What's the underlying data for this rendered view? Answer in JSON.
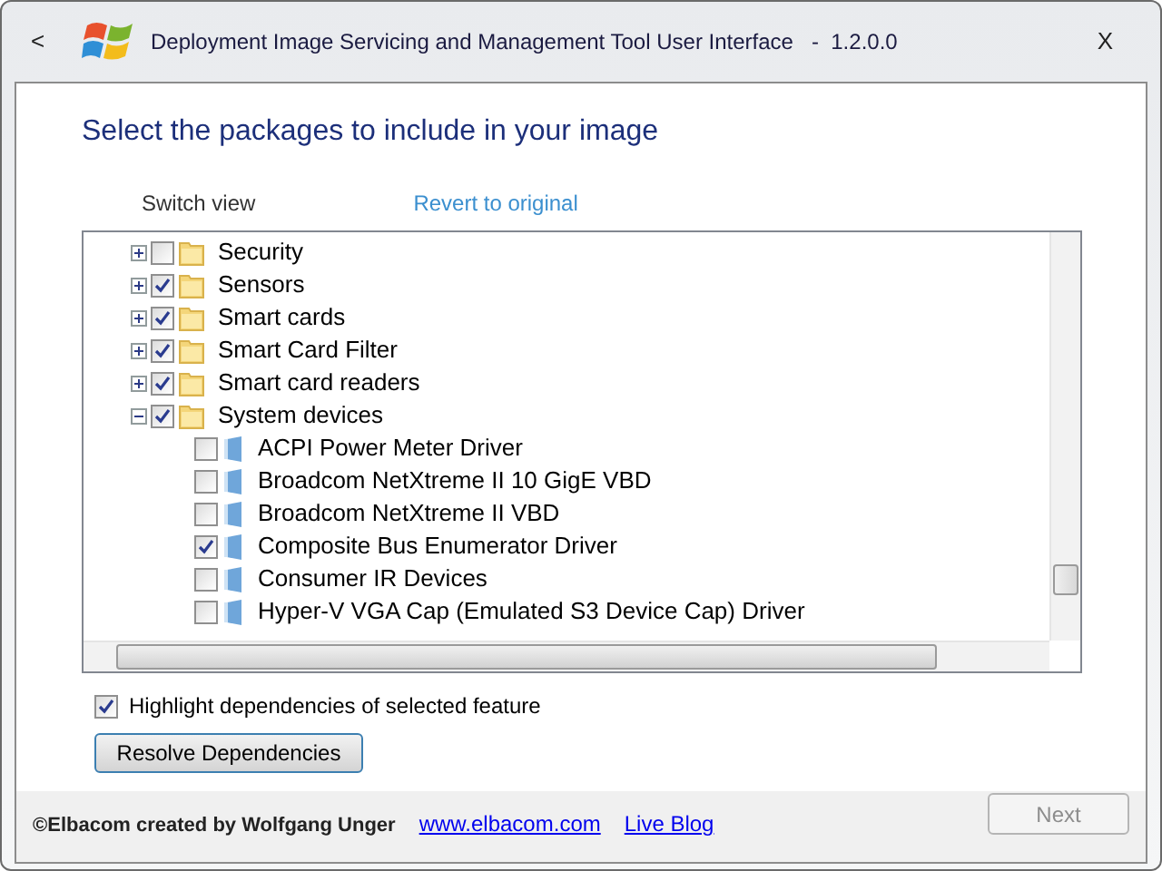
{
  "window": {
    "back": "<",
    "title": "Deployment Image Servicing and Management Tool User Interface   -  1.2.0.0",
    "close": "X"
  },
  "heading": "Select the packages to include in your image",
  "links": [
    {
      "label": "Switch view",
      "kind": "plain"
    },
    {
      "label": "Revert to original",
      "kind": "link"
    }
  ],
  "tree": {
    "nodes": [
      {
        "kind": "folder",
        "label": "Security",
        "checked": false,
        "expanded": false
      },
      {
        "kind": "folder",
        "label": "Sensors",
        "checked": true,
        "expanded": false
      },
      {
        "kind": "folder",
        "label": "Smart cards",
        "checked": true,
        "expanded": false
      },
      {
        "kind": "folder",
        "label": "Smart Card Filter",
        "checked": true,
        "expanded": false
      },
      {
        "kind": "folder",
        "label": "Smart card readers",
        "checked": true,
        "expanded": false
      },
      {
        "kind": "folder",
        "label": "System devices",
        "checked": true,
        "expanded": true,
        "children": [
          {
            "kind": "package",
            "label": "ACPI Power Meter Driver",
            "checked": false
          },
          {
            "kind": "package",
            "label": "Broadcom NetXtreme II 10 GigE VBD",
            "checked": false
          },
          {
            "kind": "package",
            "label": "Broadcom NetXtreme II VBD",
            "checked": false
          },
          {
            "kind": "package",
            "label": "Composite Bus Enumerator Driver",
            "checked": true
          },
          {
            "kind": "package",
            "label": "Consumer IR Devices",
            "checked": false
          },
          {
            "kind": "package",
            "label": "Hyper-V VGA Cap (Emulated S3 Device Cap) Driver",
            "checked": false
          }
        ]
      }
    ]
  },
  "highlight": {
    "label": "Highlight dependencies of selected feature",
    "checked": true
  },
  "resolve_button": "Resolve Dependencies",
  "footer": {
    "credit": "©Elbacom created by Wolfgang Unger",
    "links": [
      "www.elbacom.com",
      "Live Blog"
    ],
    "next": {
      "label": "Next",
      "disabled": true
    }
  }
}
